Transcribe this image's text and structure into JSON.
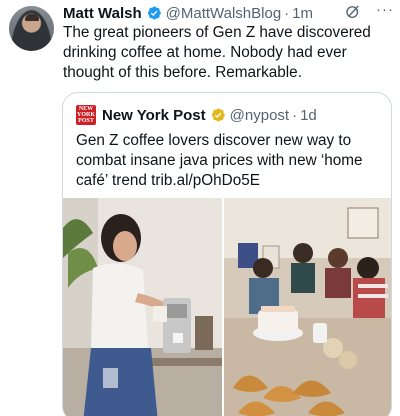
{
  "tweet": {
    "author_name": "Matt Walsh",
    "handle": "@MattWalshBlog",
    "separator": "·",
    "time": "1m",
    "text": "The great pioneers of Gen Z have discovered drinking coffee at home. Nobody had ever thought of this before. Remarkable.",
    "more": "···"
  },
  "quote": {
    "logo_line1": "NEW",
    "logo_line2": "YORK",
    "logo_line3": "POST",
    "author_name": "New York Post",
    "handle": "@nypost",
    "separator": "·",
    "time": "1d",
    "text": "Gen Z coffee lovers discover new way to combat insane java prices with new ‘home café’ trend trib.al/pOhDo5E"
  },
  "icons": {
    "verified": "verified-badge-icon",
    "verified_gold": "verified-gold-badge-icon",
    "grok": "grok-icon",
    "more": "more-options-icon"
  },
  "colors": {
    "text": "#0f1419",
    "secondary": "#536471",
    "verified_blue": "#1d9bf0",
    "verified_gold": "#e2b719",
    "nypost_red": "#cc1f26",
    "border": "#cfd9de"
  }
}
